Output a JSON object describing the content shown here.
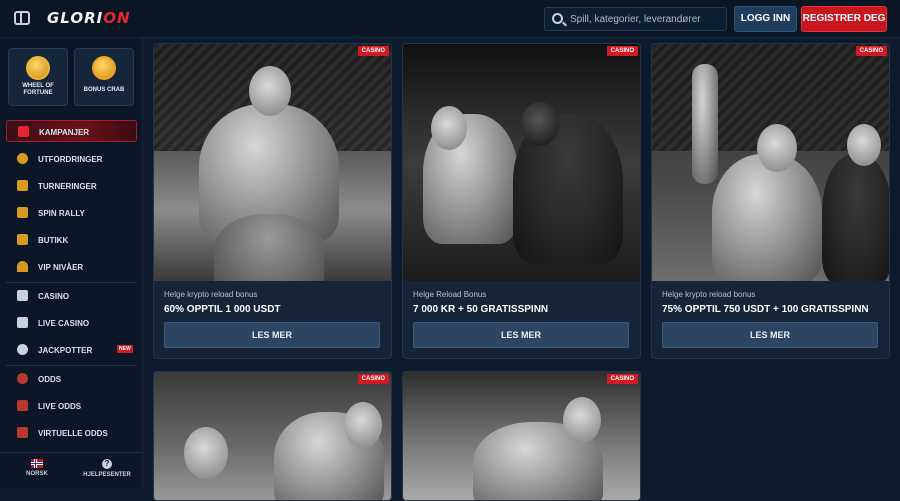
{
  "header": {
    "logo_main": "GLORI",
    "logo_accent": "ON",
    "search_placeholder": "Spill, kategorier, leverandører",
    "login_label": "LOGG INN",
    "register_label": "REGISTRER DEG",
    "menu_icon": "sidebar-toggle-icon",
    "search_icon": "search-icon"
  },
  "sidebar": {
    "promos": [
      {
        "label": "WHEEL OF FORTUNE",
        "icon": "wheel-icon"
      },
      {
        "label": "BONUS CRAB",
        "icon": "crab-claw-icon"
      }
    ],
    "items": [
      {
        "label": "KAMPANJER",
        "icon": "gift-icon"
      },
      {
        "label": "UTFORDRINGER",
        "icon": "medal-icon"
      },
      {
        "label": "TURNERINGER",
        "icon": "trophy-icon"
      },
      {
        "label": "SPIN RALLY",
        "icon": "flag-icon"
      },
      {
        "label": "BUTIKK",
        "icon": "shop-icon"
      },
      {
        "label": "VIP NIVÅER",
        "icon": "vip-icon"
      },
      {
        "label": "CASINO",
        "icon": "casino-icon"
      },
      {
        "label": "LIVE CASINO",
        "icon": "cards-icon"
      },
      {
        "label": "JACKPOTTER",
        "icon": "jackpot-icon",
        "badge": "NEW"
      },
      {
        "label": "ODDS",
        "icon": "ball-icon"
      },
      {
        "label": "LIVE ODDS",
        "icon": "live-odds-icon"
      },
      {
        "label": "VIRTUELLE ODDS",
        "icon": "virtual-odds-icon"
      }
    ],
    "bottom": {
      "language_label": "NORSK",
      "help_label": "HJELPESENTER",
      "help_glyph": "?"
    }
  },
  "accent_colors": {
    "brand_red": "#d21a24",
    "button_blue": "#2b4563"
  },
  "cards": [
    {
      "tag": "CASINO",
      "sub": "Helge krypto reload bonus",
      "title": "60% OPPTIL 1 000 USDT",
      "button": "LES MER"
    },
    {
      "tag": "CASINO",
      "sub": "Helge Reload Bonus",
      "title": "7 000 KR + 50 GRATISSPINN",
      "button": "LES MER"
    },
    {
      "tag": "CASINO",
      "sub": "Helge krypto reload bonus",
      "title": "75% OPPTIL 750 USDT + 100 GRATISSPINN",
      "button": "LES MER"
    },
    {
      "tag": "CASINO"
    },
    {
      "tag": "CASINO"
    }
  ]
}
